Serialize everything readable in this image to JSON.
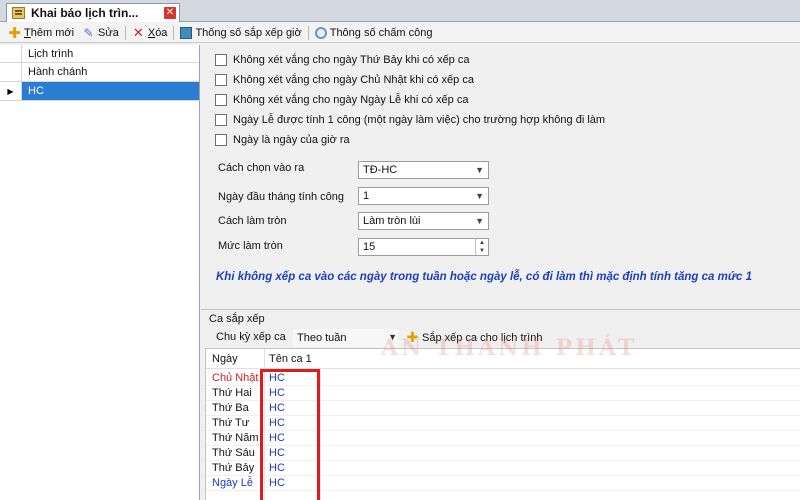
{
  "tab": {
    "title": "Khai báo lịch trìn...",
    "close_glyph": "✕",
    "icon": "calendar-icon"
  },
  "toolbar": {
    "add_label": "hêm mới",
    "add_underline": "T",
    "edit_label": "Sửa",
    "delete_label": "óa",
    "delete_underline": "X",
    "schedule_params_label": "Thống số sắp xếp giờ",
    "attendance_params_label": "Thông số chấm công"
  },
  "list": {
    "header": "Lịch trình",
    "rows": [
      {
        "label": "Hành chánh",
        "selected": false
      },
      {
        "label": "HC",
        "selected": true
      }
    ]
  },
  "options": [
    {
      "label": "Không xét vắng cho ngày Thứ Bảy khi có xếp ca",
      "checked": false
    },
    {
      "label": "Không xét vắng cho ngày Chủ Nhật khi có xếp ca",
      "checked": false
    },
    {
      "label": "Không xét vắng cho ngày Ngày Lễ khi có xếp ca",
      "checked": false
    },
    {
      "label": "Ngày Lễ được tính 1 công (một ngày làm việc) cho trường hợp không đi làm",
      "checked": false
    },
    {
      "label": "Ngày là ngày của giờ ra",
      "checked": false
    }
  ],
  "fields": {
    "entry_method_label": "Cách chọn vào ra",
    "entry_method_value": "TĐ-HC",
    "start_day_label": "Ngày đầu tháng tính công",
    "start_day_value": "1",
    "rounding_label": "Cách làm tròn",
    "rounding_value": "Làm tròn lùi",
    "rounding_level_label": "Mức làm tròn",
    "rounding_level_value": "15"
  },
  "note": "Khi không xếp ca vào các ngày trong tuần hoặc ngày lễ, có đi làm thì mặc định tính tăng ca mức 1",
  "schedule": {
    "group_title": "Ca sắp xếp",
    "cycle_label": "Chu kỳ xếp ca",
    "cycle_value": "Theo tuần",
    "arrange_button": "Sắp xếp ca cho lịch trình",
    "columns": [
      "Ngày",
      "Tên ca 1"
    ],
    "rows": [
      {
        "day": "Chủ Nhật",
        "shift": "HC",
        "day_color": "#d42020"
      },
      {
        "day": "Thứ Hai",
        "shift": "HC",
        "day_color": "#111111"
      },
      {
        "day": "Thứ Ba",
        "shift": "HC",
        "day_color": "#111111"
      },
      {
        "day": "Thứ Tư",
        "shift": "HC",
        "day_color": "#111111"
      },
      {
        "day": "Thứ Năm",
        "shift": "HC",
        "day_color": "#111111"
      },
      {
        "day": "Thứ Sáu",
        "shift": "HC",
        "day_color": "#111111"
      },
      {
        "day": "Thứ Bảy",
        "shift": "HC",
        "day_color": "#111111"
      },
      {
        "day": "Ngày Lễ",
        "shift": "HC",
        "day_color": "#1a3bbf"
      }
    ]
  },
  "watermark": "AN THANH PHÁT",
  "colors": {
    "selection": "#2b7cd3",
    "note": "#1d3fbf",
    "highlight": "#e01b1b",
    "shift_text": "#1a3bbf"
  }
}
